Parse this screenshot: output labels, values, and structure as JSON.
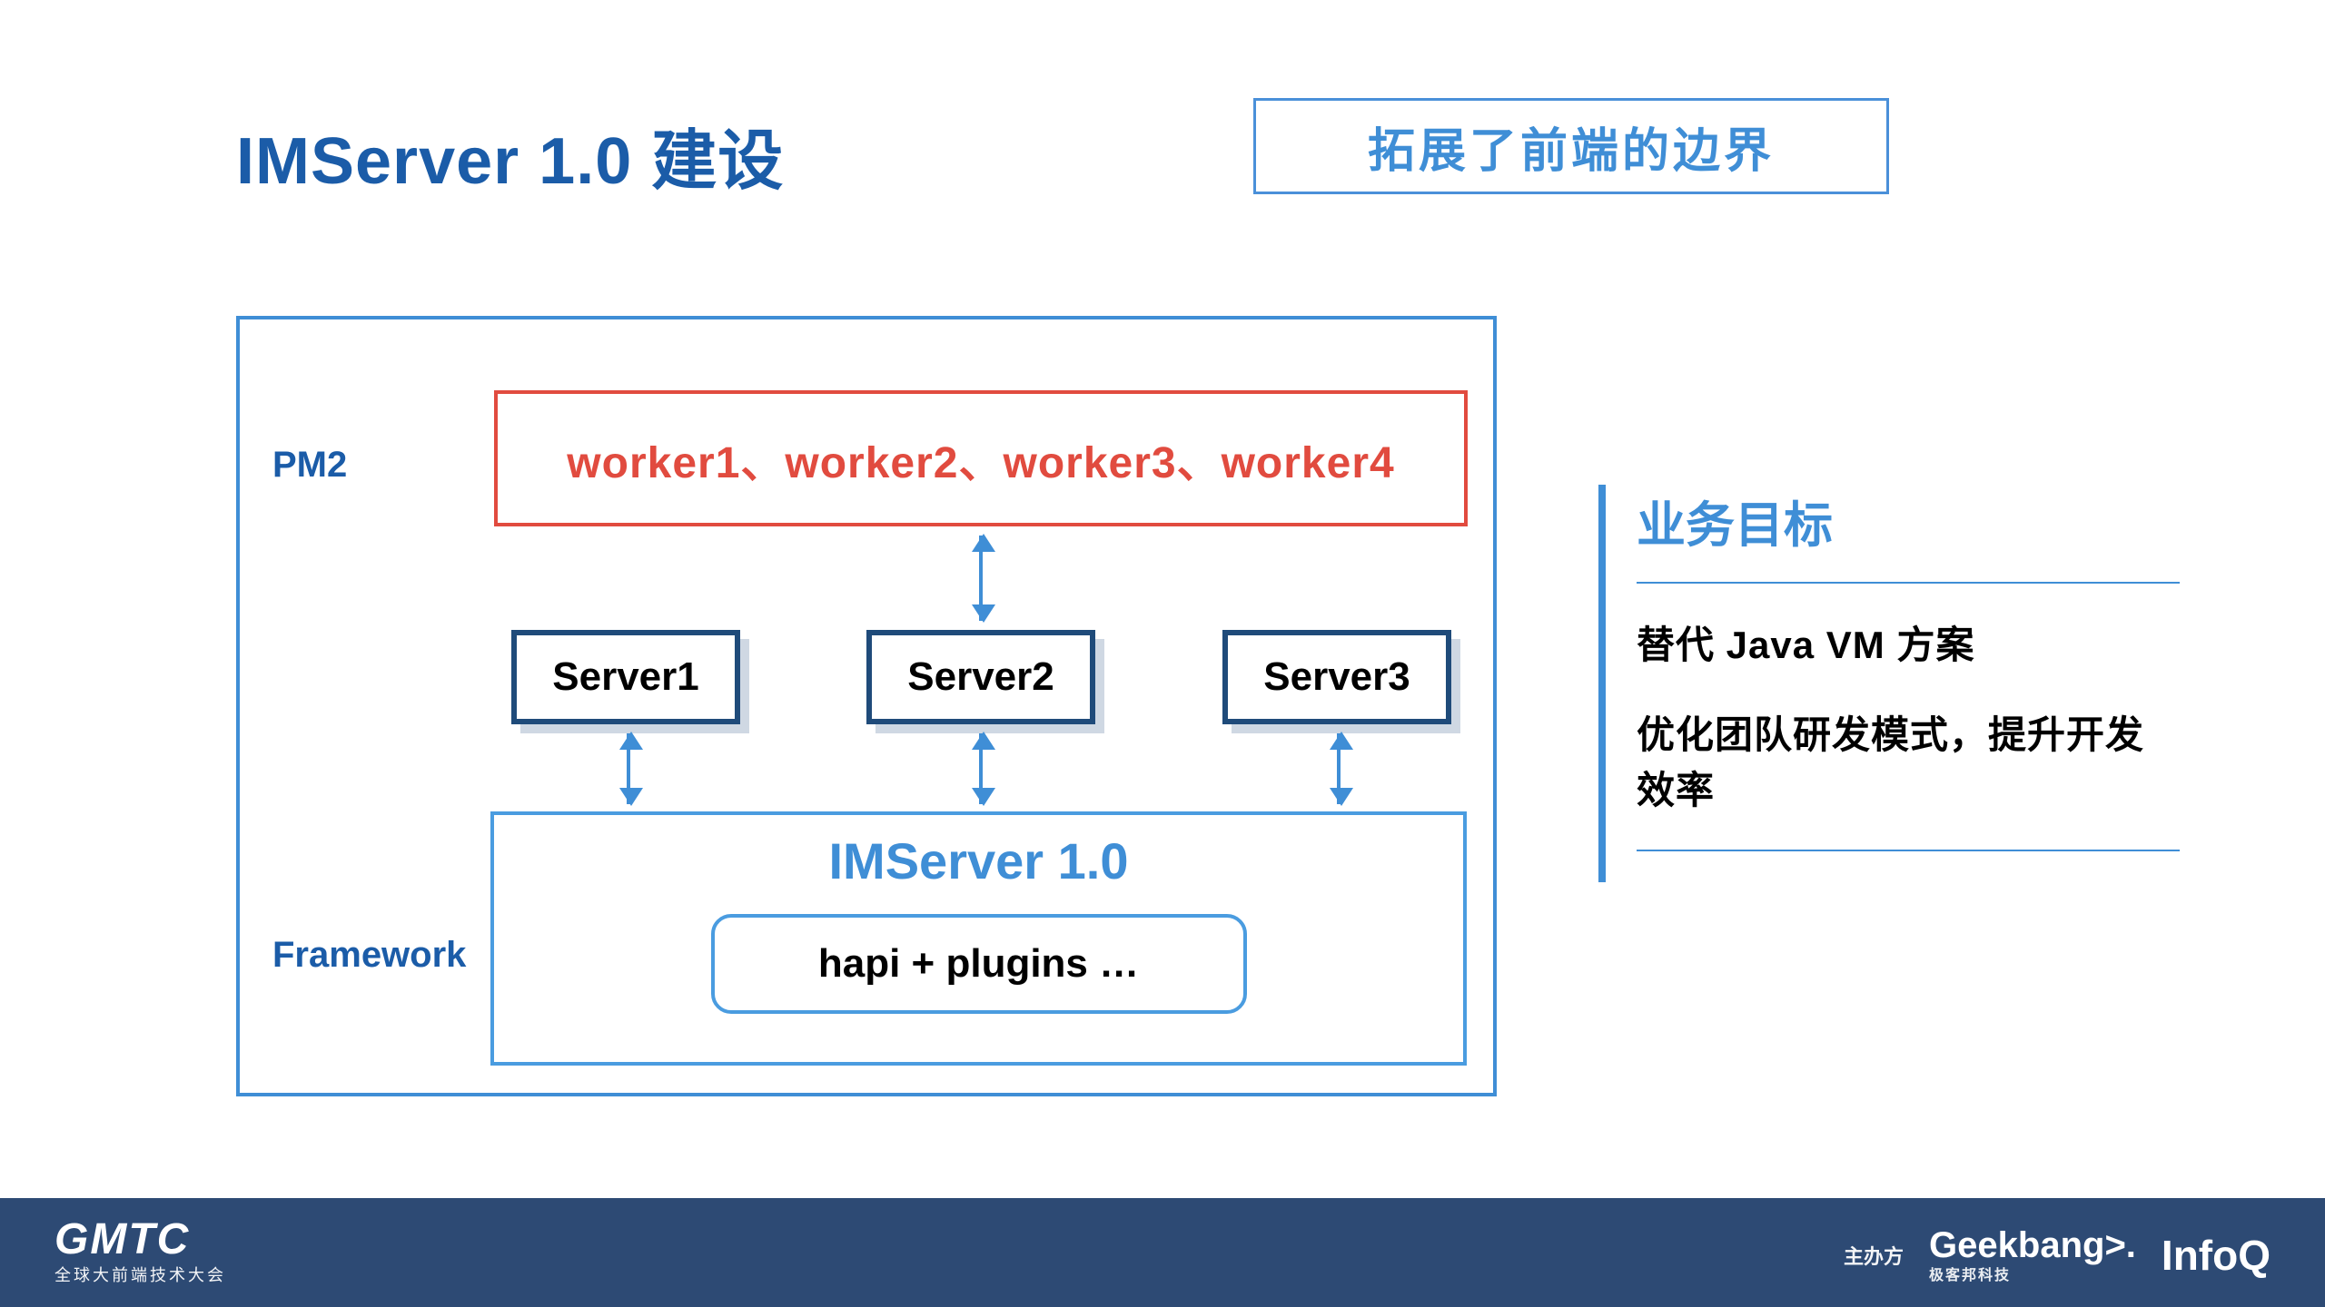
{
  "title": "IMServer 1.0 建设",
  "badge": "拓展了前端的边界",
  "diagram": {
    "label_pm2": "PM2",
    "label_framework": "Framework",
    "workers": "worker1、worker2、worker3、worker4",
    "servers": {
      "s1": "Server1",
      "s2": "Server2",
      "s3": "Server3"
    },
    "framework_title": "IMServer 1.0",
    "hapi": "hapi + plugins …"
  },
  "goals": {
    "heading": "业务目标",
    "items": [
      "替代 Java VM 方案",
      "优化团队研发模式，提升开发效率"
    ]
  },
  "footer": {
    "logo": "GMTC",
    "logo_sub": "全球大前端技术大会",
    "sponsor_label": "主办方",
    "geekbang": "Geekbang>.",
    "geekbang_sub": "极客邦科技",
    "infoq": "InfoQ"
  }
}
